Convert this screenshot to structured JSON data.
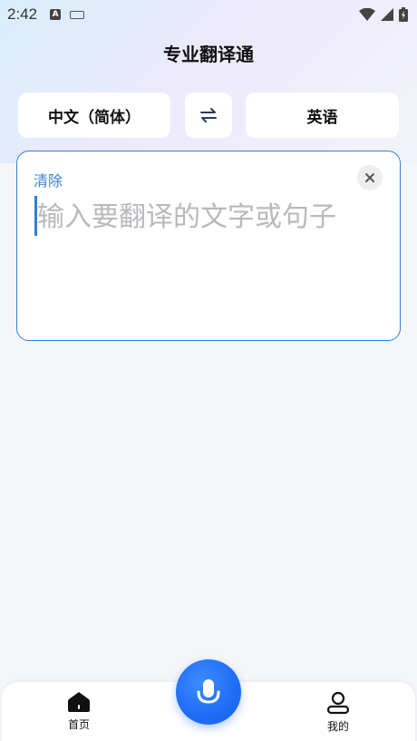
{
  "status_bar": {
    "time": "2:42",
    "input_badge": "A"
  },
  "header": {
    "title": "专业翻译通"
  },
  "languages": {
    "source": "中文（简体）",
    "target": "英语"
  },
  "input_card": {
    "clear_label": "清除",
    "placeholder": "输入要翻译的文字或句子",
    "value": ""
  },
  "bottom_nav": {
    "home_label": "首页",
    "mine_label": "我的"
  },
  "colors": {
    "accent": "#2f7fd9",
    "mic": "#1f6cf5"
  }
}
